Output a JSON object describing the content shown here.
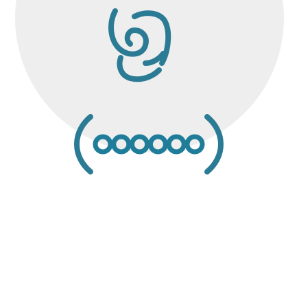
{
  "illustration": {
    "icon": "user-password-icon",
    "background_color": "#eeeeee",
    "stroke_color": "#2b7b95",
    "dot_color": "#1f7d9a",
    "password_mask_length": 6
  }
}
